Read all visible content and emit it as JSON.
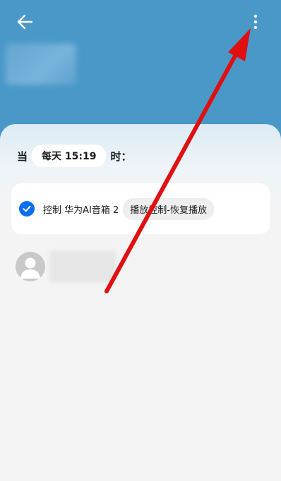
{
  "header": {
    "back_icon": "arrow-left-icon",
    "more_icon": "more-vertical-icon",
    "color": "#4a98c8"
  },
  "condition": {
    "prefix": "当",
    "time": "每天 15:19",
    "suffix": "时："
  },
  "action": {
    "checked": true,
    "label": "控制 华为AI音箱 2",
    "detail": "播放控制-恢复播放",
    "accent": "#0a6ef0"
  },
  "member": {
    "avatar_icon": "person-icon"
  },
  "annotation": {
    "color": "#e01010"
  }
}
